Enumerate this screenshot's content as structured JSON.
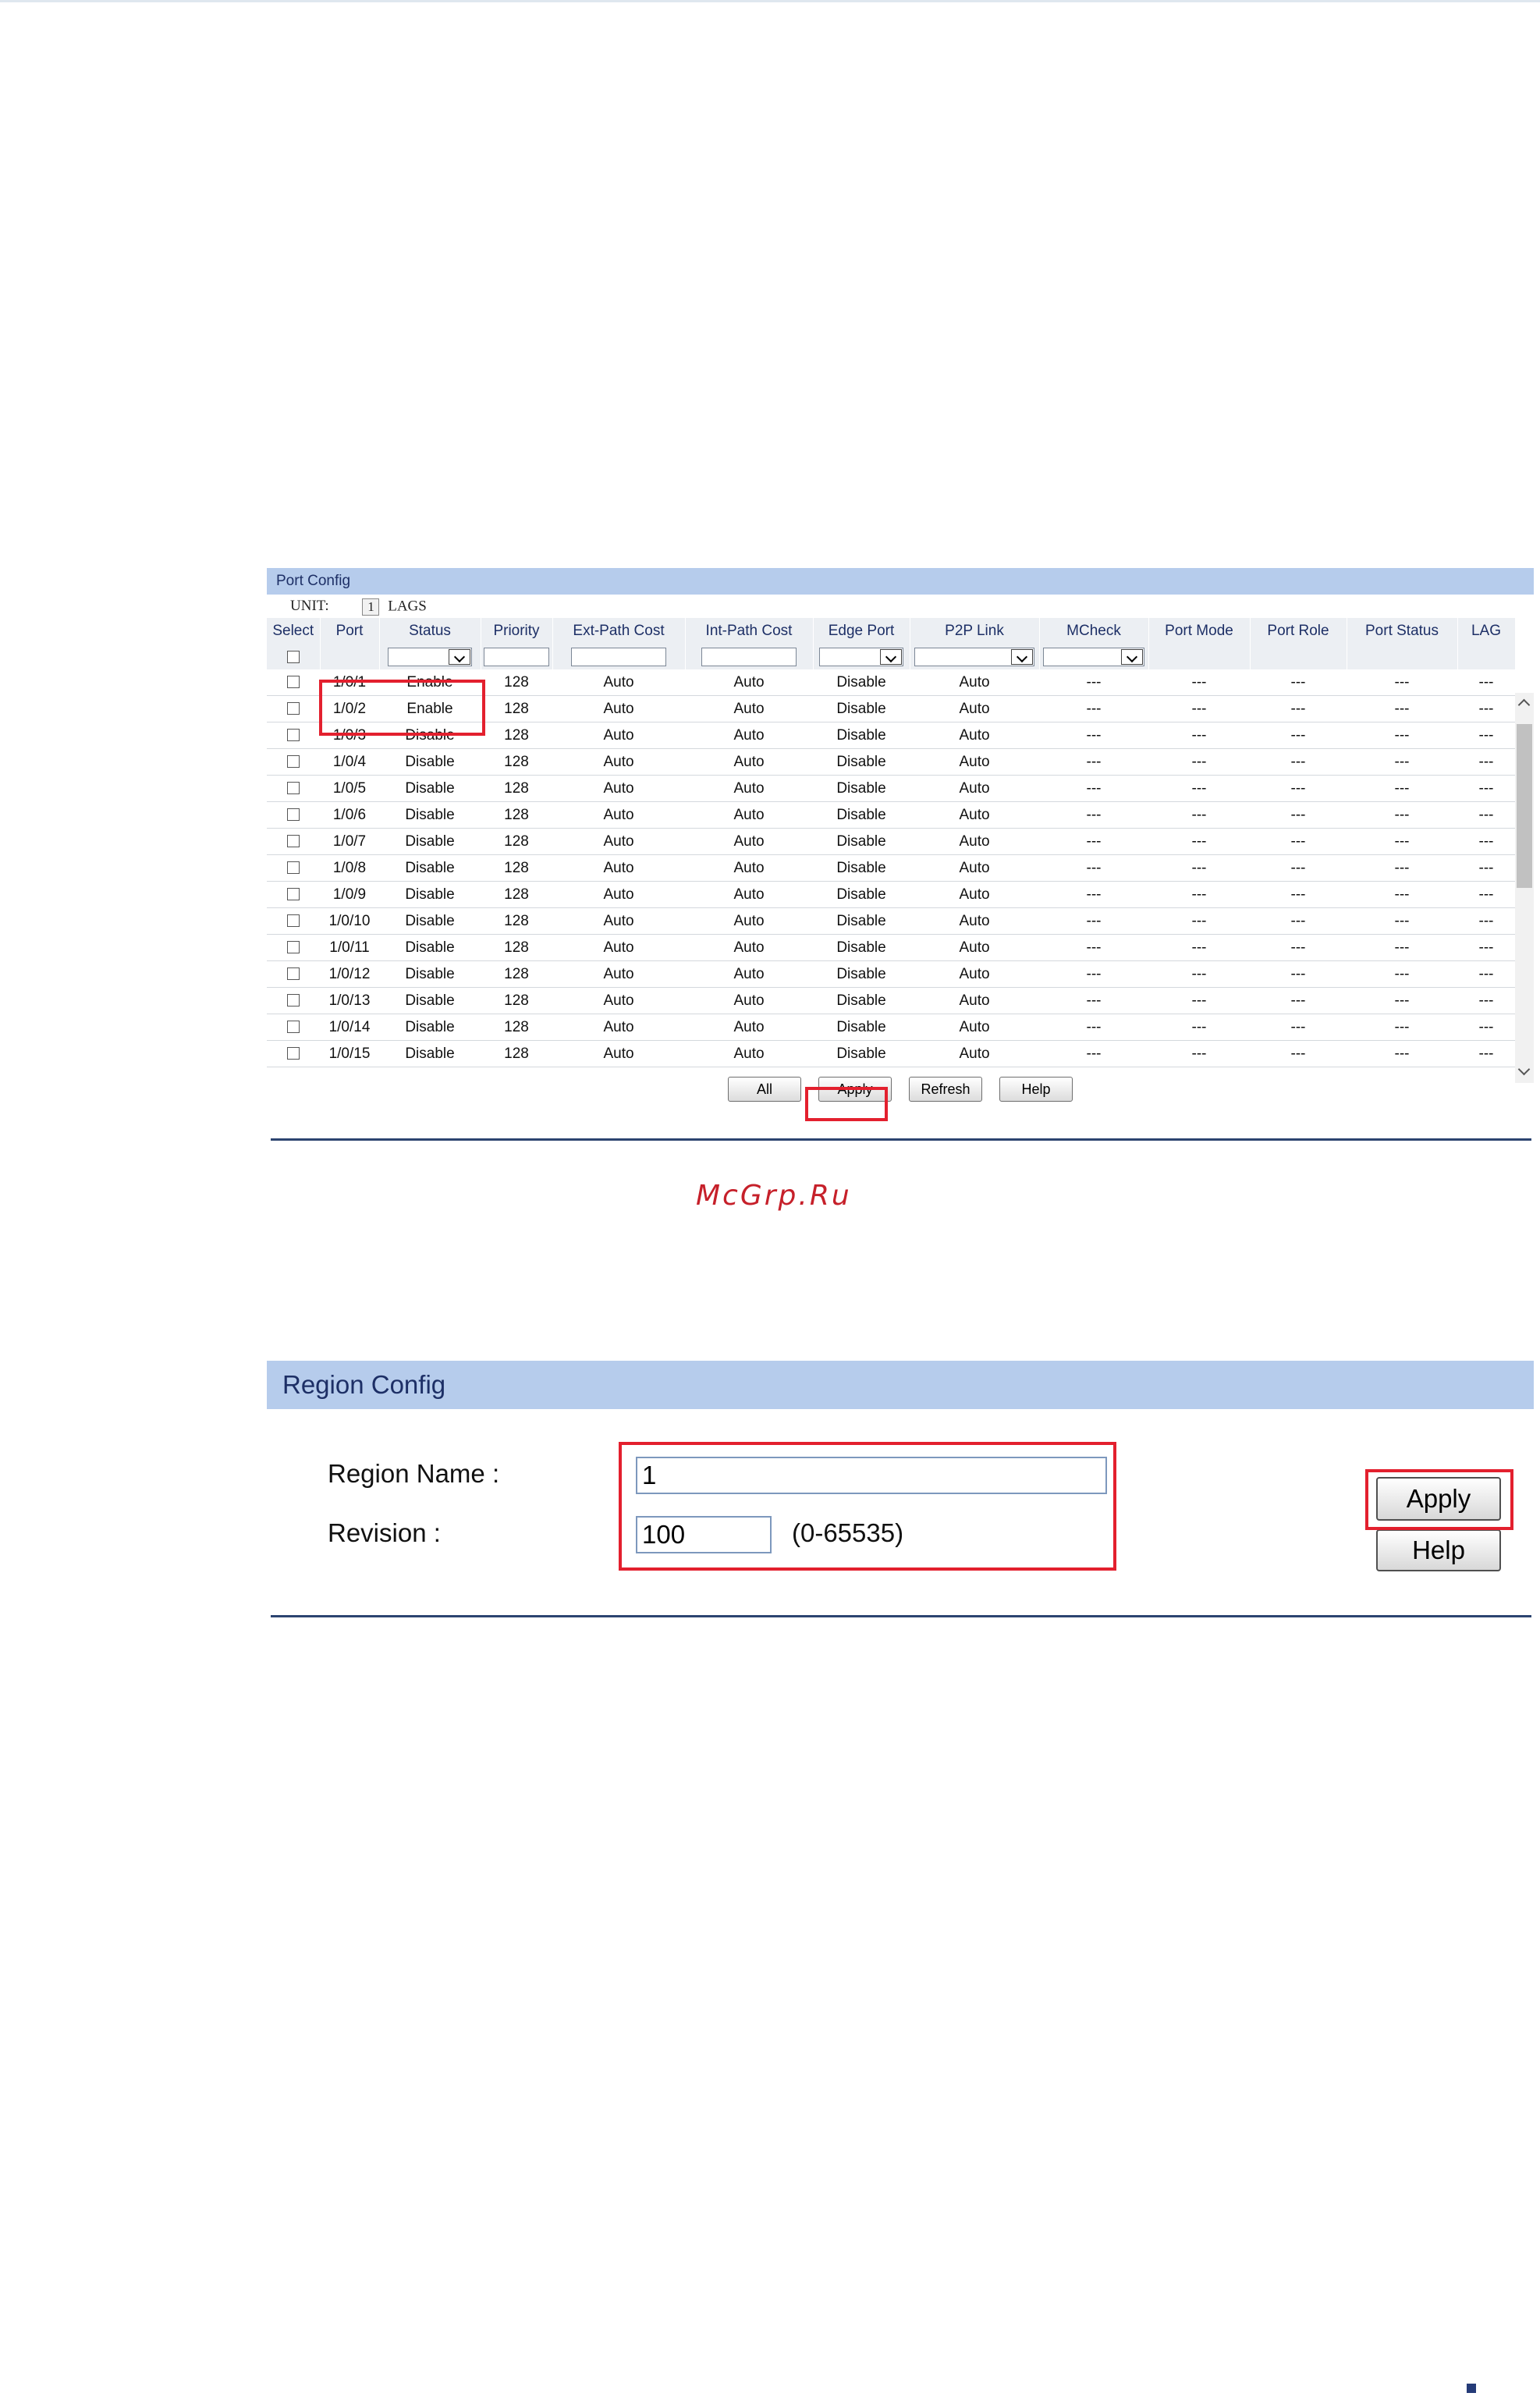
{
  "port_config": {
    "title": "Port Config",
    "unit_label": "UNIT:",
    "unit_value": "1",
    "lags_label": "LAGS",
    "columns": [
      "Select",
      "Port",
      "Status",
      "Priority",
      "Ext-Path Cost",
      "Int-Path Cost",
      "Edge Port",
      "P2P Link",
      "MCheck",
      "Port Mode",
      "Port Role",
      "Port Status",
      "LAG"
    ],
    "rows": [
      {
        "port": "1/0/1",
        "status": "Enable",
        "priority": "128",
        "ext": "Auto",
        "int": "Auto",
        "edge": "Disable",
        "p2p": "Auto",
        "mcheck": "---",
        "mode": "---",
        "role": "---",
        "pstatus": "---",
        "lag": "---"
      },
      {
        "port": "1/0/2",
        "status": "Enable",
        "priority": "128",
        "ext": "Auto",
        "int": "Auto",
        "edge": "Disable",
        "p2p": "Auto",
        "mcheck": "---",
        "mode": "---",
        "role": "---",
        "pstatus": "---",
        "lag": "---"
      },
      {
        "port": "1/0/3",
        "status": "Disable",
        "priority": "128",
        "ext": "Auto",
        "int": "Auto",
        "edge": "Disable",
        "p2p": "Auto",
        "mcheck": "---",
        "mode": "---",
        "role": "---",
        "pstatus": "---",
        "lag": "---"
      },
      {
        "port": "1/0/4",
        "status": "Disable",
        "priority": "128",
        "ext": "Auto",
        "int": "Auto",
        "edge": "Disable",
        "p2p": "Auto",
        "mcheck": "---",
        "mode": "---",
        "role": "---",
        "pstatus": "---",
        "lag": "---"
      },
      {
        "port": "1/0/5",
        "status": "Disable",
        "priority": "128",
        "ext": "Auto",
        "int": "Auto",
        "edge": "Disable",
        "p2p": "Auto",
        "mcheck": "---",
        "mode": "---",
        "role": "---",
        "pstatus": "---",
        "lag": "---"
      },
      {
        "port": "1/0/6",
        "status": "Disable",
        "priority": "128",
        "ext": "Auto",
        "int": "Auto",
        "edge": "Disable",
        "p2p": "Auto",
        "mcheck": "---",
        "mode": "---",
        "role": "---",
        "pstatus": "---",
        "lag": "---"
      },
      {
        "port": "1/0/7",
        "status": "Disable",
        "priority": "128",
        "ext": "Auto",
        "int": "Auto",
        "edge": "Disable",
        "p2p": "Auto",
        "mcheck": "---",
        "mode": "---",
        "role": "---",
        "pstatus": "---",
        "lag": "---"
      },
      {
        "port": "1/0/8",
        "status": "Disable",
        "priority": "128",
        "ext": "Auto",
        "int": "Auto",
        "edge": "Disable",
        "p2p": "Auto",
        "mcheck": "---",
        "mode": "---",
        "role": "---",
        "pstatus": "---",
        "lag": "---"
      },
      {
        "port": "1/0/9",
        "status": "Disable",
        "priority": "128",
        "ext": "Auto",
        "int": "Auto",
        "edge": "Disable",
        "p2p": "Auto",
        "mcheck": "---",
        "mode": "---",
        "role": "---",
        "pstatus": "---",
        "lag": "---"
      },
      {
        "port": "1/0/10",
        "status": "Disable",
        "priority": "128",
        "ext": "Auto",
        "int": "Auto",
        "edge": "Disable",
        "p2p": "Auto",
        "mcheck": "---",
        "mode": "---",
        "role": "---",
        "pstatus": "---",
        "lag": "---"
      },
      {
        "port": "1/0/11",
        "status": "Disable",
        "priority": "128",
        "ext": "Auto",
        "int": "Auto",
        "edge": "Disable",
        "p2p": "Auto",
        "mcheck": "---",
        "mode": "---",
        "role": "---",
        "pstatus": "---",
        "lag": "---"
      },
      {
        "port": "1/0/12",
        "status": "Disable",
        "priority": "128",
        "ext": "Auto",
        "int": "Auto",
        "edge": "Disable",
        "p2p": "Auto",
        "mcheck": "---",
        "mode": "---",
        "role": "---",
        "pstatus": "---",
        "lag": "---"
      },
      {
        "port": "1/0/13",
        "status": "Disable",
        "priority": "128",
        "ext": "Auto",
        "int": "Auto",
        "edge": "Disable",
        "p2p": "Auto",
        "mcheck": "---",
        "mode": "---",
        "role": "---",
        "pstatus": "---",
        "lag": "---"
      },
      {
        "port": "1/0/14",
        "status": "Disable",
        "priority": "128",
        "ext": "Auto",
        "int": "Auto",
        "edge": "Disable",
        "p2p": "Auto",
        "mcheck": "---",
        "mode": "---",
        "role": "---",
        "pstatus": "---",
        "lag": "---"
      },
      {
        "port": "1/0/15",
        "status": "Disable",
        "priority": "128",
        "ext": "Auto",
        "int": "Auto",
        "edge": "Disable",
        "p2p": "Auto",
        "mcheck": "---",
        "mode": "---",
        "role": "---",
        "pstatus": "---",
        "lag": "---"
      }
    ],
    "buttons": {
      "all": "All",
      "apply": "Apply",
      "refresh": "Refresh",
      "help": "Help"
    }
  },
  "watermark": "McGrp.Ru",
  "region_config": {
    "title": "Region Config",
    "region_name_label": "Region Name :",
    "region_name_value": "1",
    "revision_label": "Revision :",
    "revision_value": "100",
    "revision_hint": "(0-65535)",
    "apply_label": "Apply",
    "help_label": "Help"
  },
  "colors": {
    "header_bg": "#b6ccec",
    "highlight_red": "#e3202e",
    "rule_blue": "#2c4470"
  }
}
